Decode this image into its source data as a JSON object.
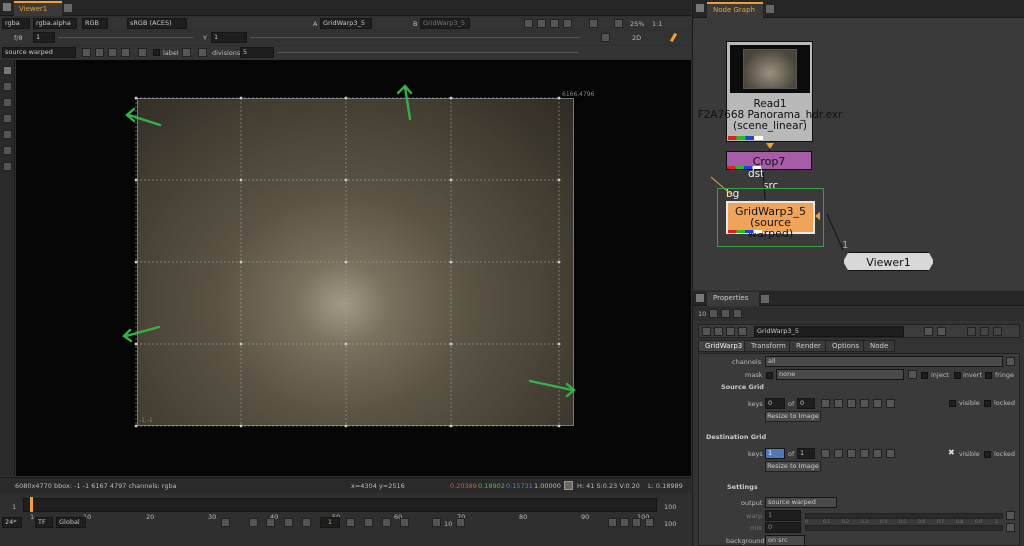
{
  "viewer": {
    "tab": "Viewer1",
    "toolbar1": {
      "channels": "rgba",
      "alpha": "rgba.alpha",
      "colorspace_rgb": "RGB",
      "display": "sRGB (ACES)",
      "input_a_label": "A",
      "input_a": "GridWarp3_5",
      "input_b_label": "B",
      "input_b": "GridWarp3_5",
      "zoom": "25%",
      "ratio": "1:1"
    },
    "toolbar2": {
      "fstop": "f/8",
      "gain_val": "1",
      "gamma_label": "Y",
      "gamma_val": "1",
      "mode": "2D"
    },
    "toolbar3": {
      "view_select": "source warped",
      "label_text": "label",
      "divisions_label": "divisions",
      "divisions_val": "5"
    },
    "overlay": {
      "top_right_coord": "6166,4796",
      "bottom_left_coord": "-1,-1"
    },
    "status": {
      "info": "6080x4770  bbox: -1 -1 6167 4797 channels: rgba",
      "coords": "x=4304 y=2516",
      "r": "0.20389",
      "g": "0.18902",
      "b": "0.15731",
      "a": "1.00000",
      "hsv": "H: 41 S:0.23 V:0.20",
      "lum": "L: 0.18989"
    },
    "timeline": {
      "start_frame": "1",
      "ticks": [
        "1",
        "10",
        "20",
        "30",
        "40",
        "50",
        "60",
        "70",
        "80",
        "90",
        "100"
      ],
      "end_frame": "100",
      "fps": "24*",
      "tf": "TF",
      "range": "Global",
      "current_frame": "1",
      "step": "10",
      "end_box": "100"
    }
  },
  "node_graph": {
    "tab": "Node Graph",
    "read_node": {
      "line1": "Read1",
      "line2": "F2A7668 Panorama_hdr.exr",
      "line3": "(scene_linear)"
    },
    "crop_node": "Crop7",
    "gridwarp_node": {
      "line1": "GridWarp3_5",
      "line2": "(source warped)"
    },
    "viewer_node": "Viewer1",
    "pipe_dst": "dst",
    "pipe_src": "src",
    "pipe_bg": "bg",
    "viewer_input_num": "1",
    "colors": {
      "read": "#b9b9b9",
      "crop": "#a65ca6",
      "gridwarp": "#f0a45a",
      "viewer": "#d8d8d8",
      "selection": "#36a044"
    }
  },
  "properties": {
    "tab": "Properties",
    "count": "10",
    "node_name": "GridWarp3_5",
    "tabs": [
      "GridWarp3",
      "Transform",
      "Render",
      "Options",
      "Node"
    ],
    "channels_label": "channels",
    "channels_val": "all",
    "mask_label": "mask",
    "mask_val": "none",
    "inject_label": "inject",
    "invert_label": "invert",
    "fringe_label": "fringe",
    "source_grid_title": "Source Grid",
    "src_keys_label": "keys",
    "src_keys_val": "0",
    "src_of": "of",
    "src_of_val": "0",
    "src_visible": "visible",
    "src_locked": "locked",
    "resize_src": "Resize to Image",
    "dest_grid_title": "Destination Grid",
    "dst_keys_label": "keys",
    "dst_keys_val": "1",
    "dst_of": "of",
    "dst_of_val": "1",
    "dst_visible": "visible",
    "dst_locked": "locked",
    "resize_dst": "Resize to Image",
    "settings_title": "Settings",
    "output_label": "output",
    "output_val": "source warped",
    "warp_label": "warp",
    "warp_val": "1",
    "mix_label": "mix",
    "mix_val": "0",
    "background_label": "background",
    "background_val": "on src",
    "slider_ticks": [
      "0",
      "0.1",
      "0.2",
      "0.3",
      "0.4",
      "0.5",
      "0.6",
      "0.7",
      "0.8",
      "0.9",
      "1"
    ]
  }
}
